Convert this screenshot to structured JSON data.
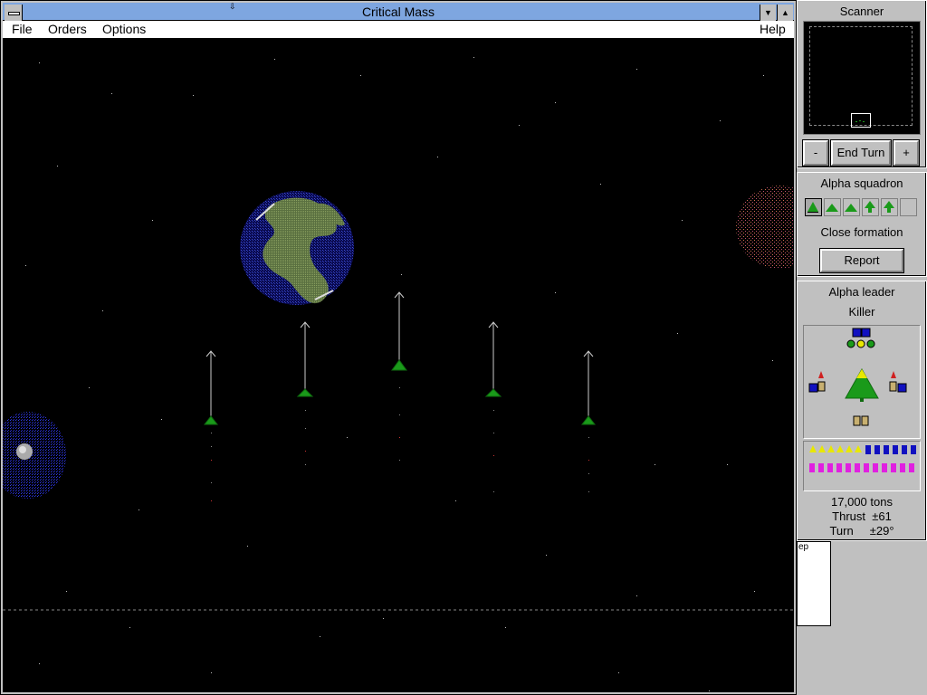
{
  "window": {
    "title": "Critical Mass"
  },
  "menu": {
    "file": "File",
    "orders": "Orders",
    "options": "Options",
    "help": "Help"
  },
  "scanner": {
    "title": "Scanner",
    "minus_label": "-",
    "end_turn_label": "End Turn",
    "plus_label": "+"
  },
  "squadron": {
    "title": "Alpha squadron",
    "formation": "Close formation",
    "report_label": "Report"
  },
  "leader": {
    "title": "Alpha leader",
    "ship_name": "Killer",
    "mass": "17,000 tons",
    "thrust_label": "Thrust",
    "thrust_value": "±61",
    "turn_label": "Turn",
    "turn_value": "±29°"
  },
  "background_window": {
    "partial_text": "ep"
  },
  "colors": {
    "titlebar": "#7ea6e0",
    "ship_green": "#1a9a1a",
    "planet_blue": "#2b3cb0",
    "land_green": "#6f8a4a",
    "shield_blue": "#1010c0",
    "missile_yellow": "#e8e800",
    "missile_magenta": "#e020e0"
  }
}
